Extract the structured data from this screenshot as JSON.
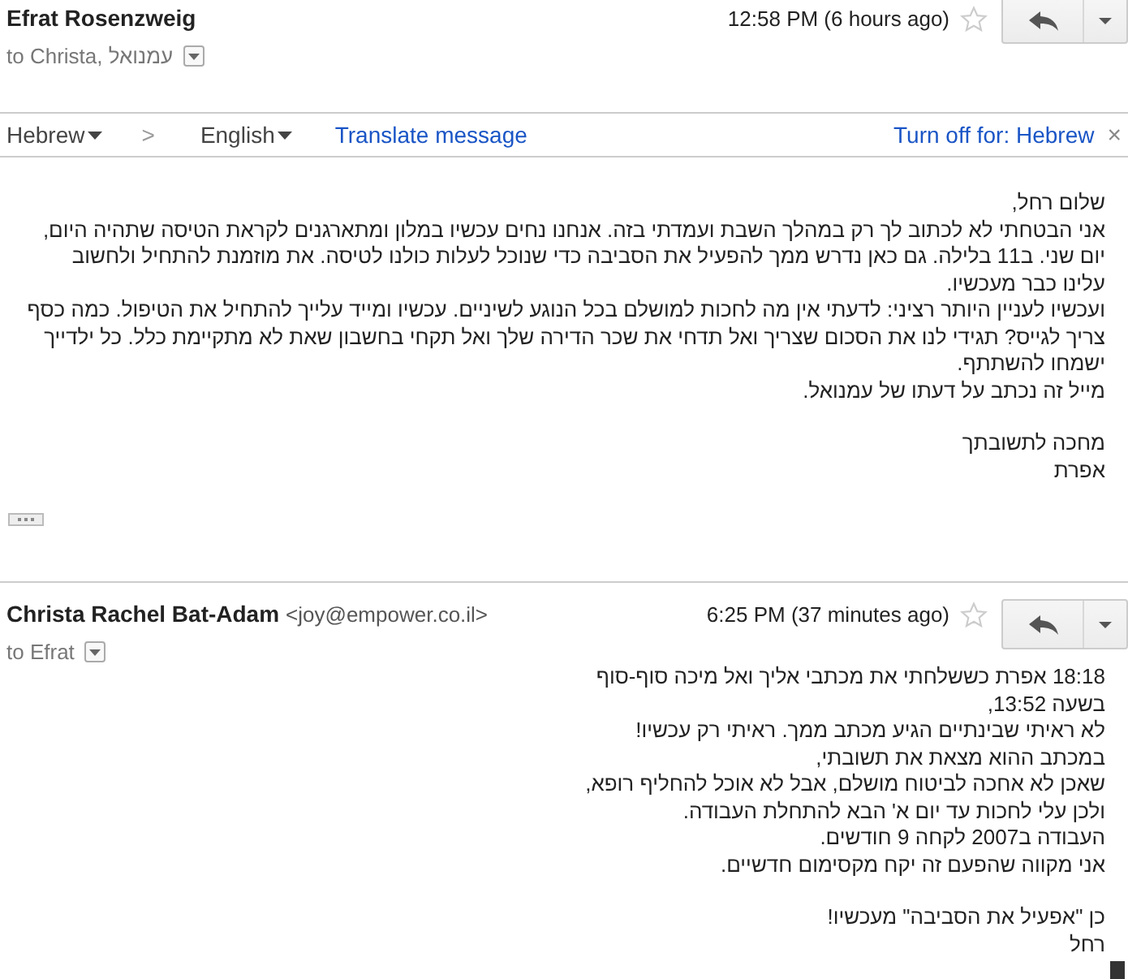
{
  "messages": [
    {
      "sender": "Efrat Rosenzweig",
      "recipients": "to Christa, עמנואל",
      "time": "12:58 PM (6 hours ago)",
      "starred": false,
      "translate_bar": {
        "source": "Hebrew",
        "arrow": ">",
        "target": "English",
        "action": "Translate message",
        "turn_off": "Turn off for: Hebrew",
        "close": "×"
      },
      "blocks": [
        [
          "שלום רחל,",
          "אני הבטחתי לא לכתוב לך רק במהלך השבת ועמדתי בזה. אנחנו נחים עכשיו במלון ומתארגנים לקראת הטיסה שתהיה היום, יום שני. ב11 בלילה. גם כאן נדרש ממך להפעיל את הסביבה כדי שנוכל לעלות כולנו לטיסה. את מוזמנת להתחיל ולחשוב עלינו כבר מעכשיו.",
          "ועכשיו לעניין היותר רציני: לדעתי אין מה לחכות למושלם בכל הנוגע לשיניים. עכשיו ומייד עלייך להתחיל את הטיפול. כמה כסף צריך לגייס? תגידי לנו את הסכום שצריך ואל תדחי את שכר הדירה שלך ואל תקחי בחשבון שאת לא מתקיימת כלל. כל ילדייך ישמחו להשתתף.",
          "מייל זה נכתב על דעתו של עמנואל."
        ],
        [
          "מחכה לתשובתך",
          "אפרת"
        ]
      ],
      "trimmed": true
    },
    {
      "sender": "Christa Rachel Bat-Adam",
      "email": "<joy@empower.co.il>",
      "recipients": "to Efrat",
      "time": "6:25 PM (37 minutes ago)",
      "starred": false,
      "blocks": [
        [
          "18:18 אפרת  כששלחתי את מכתבי אליך ואל מיכה סוף-סוף",
          "בשעה 13:52,",
          "לא ראיתי שבינתיים הגיע מכתב ממך. ראיתי רק עכשיו!",
          "במכתב ההוא מצאת את תשובתי,",
          "שאכן לא אחכה לביטוח מושלם, אבל לא אוכל להחליף רופא,",
          "ולכן עלי לחכות עד יום א' הבא להתחלת העבודה.",
          "העבודה ב2007 לקחה 9 חודשים.",
          "אני מקווה שהפעם זה יקח מקסימום חדשיים."
        ],
        [
          "כן \"אפעיל את הסביבה\" מעכשיו!",
          "רחל"
        ]
      ]
    }
  ]
}
